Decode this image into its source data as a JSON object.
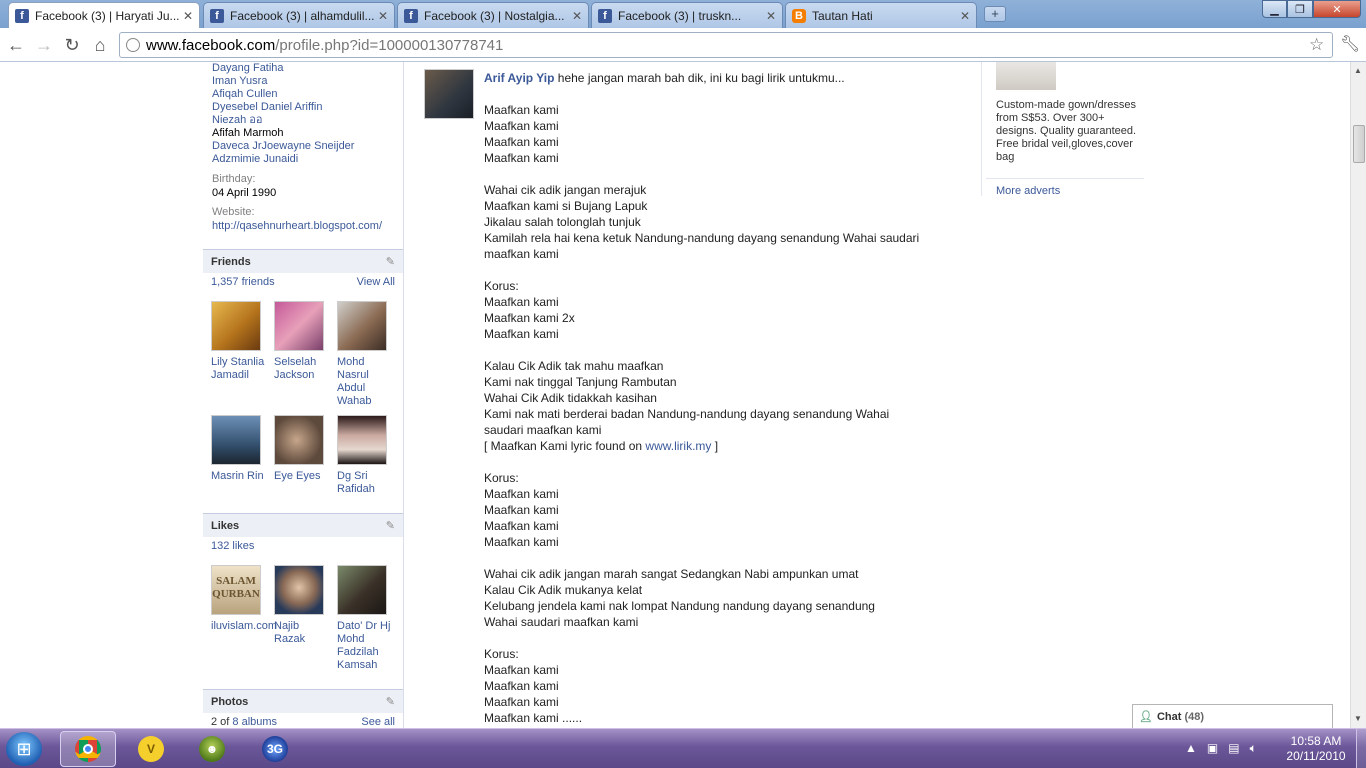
{
  "browser": {
    "tabs": [
      {
        "title": "Facebook (3) | Haryati Ju...",
        "icon": "facebook-favicon",
        "active": true
      },
      {
        "title": "Facebook (3) | alhamdulil...",
        "icon": "facebook-favicon",
        "active": false
      },
      {
        "title": "Facebook (3) | Nostalgia...",
        "icon": "facebook-favicon",
        "active": false
      },
      {
        "title": "Facebook (3) | truskn...",
        "icon": "facebook-favicon",
        "active": false
      },
      {
        "title": "Tautan Hati",
        "icon": "blogger-favicon",
        "active": false
      }
    ],
    "favicon_facebook": "f",
    "favicon_blogger": "B",
    "url_host": "www.facebook.com",
    "url_path": "/profile.php?id=100000130778741"
  },
  "left": {
    "family": [
      "Dayang Fatiha",
      "Iman Yusra",
      "Afiqah Cullen",
      "Dyesebel Daniel Ariffin",
      "Niezah ออ",
      "Afifah Marmoh",
      "Daveca JrJoewayne Sneijder",
      "Adzmimie Junaidi"
    ],
    "birthday_label": "Birthday:",
    "birthday_value": "04 April 1990",
    "website_label": "Website:",
    "website_value": "http://qasehnurheart.blogspot.com/",
    "friends": {
      "title": "Friends",
      "count": "1,357 friends",
      "view_all": "View All",
      "people": [
        "Lily Stanlia Jamadil",
        "Selselah Jackson",
        "Mohd Nasrul Abdul Wahab",
        "Masrin Rin",
        "Eye Eyes",
        "Dg Sri Rafidah"
      ]
    },
    "likes": {
      "title": "Likes",
      "count": "132 likes",
      "pages": [
        "iluvislam.com",
        "Najib Razak",
        "Dato' Dr Hj Mohd Fadzilah Kamsah"
      ],
      "thumb_text": "SALAM QURBAN"
    },
    "photos": {
      "title": "Photos",
      "count_prefix": "2 of ",
      "count_link": "8 albums",
      "see_all": "See all"
    }
  },
  "post": {
    "author": "Arif Ayip Yip",
    "intro": " hehe jangan marah bah dik, ini ku bagi lirik untukmu...",
    "lyrics_part1": "Maafkan kami\nMaafkan kami\nMaafkan kami\nMaafkan kami\n\nWahai cik adik jangan merajuk\nMaafkan kami si Bujang Lapuk\nJikalau salah tolonglah tunjuk\nKamilah rela hai kena ketuk Nandung-nandung dayang senandung Wahai saudari maafkan kami\n\nKorus:\nMaafkan kami\nMaafkan kami 2x\nMaafkan kami\n\nKalau Cik Adik tak mahu maafkan\nKami nak tinggal Tanjung Rambutan\nWahai Cik Adik tidakkah kasihan\nKami nak mati berderai badan Nandung-nandung dayang senandung Wahai saudari maafkan kami",
    "lyric_found_prefix": "[ Maafkan Kami lyric found on ",
    "lyric_found_link": "www.lirik.my",
    "lyric_found_suffix": " ]",
    "lyrics_part2": "\nKorus:\nMaafkan kami\nMaafkan kami\nMaafkan kami\nMaafkan kami\n\nWahai cik adik jangan marah sangat Sedangkan Nabi ampunkan umat\nKalau Cik Adik mukanya kelat\nKelubang jendela kami nak lompat Nandung nandung dayang senandung\nWahai saudari maafkan kami\n\nKorus:\nMaafkan kami\nMaafkan kami\nMaafkan kami\nMaafkan kami ......"
  },
  "ad": {
    "text": "Custom-made gown/dresses from S$53. Over 300+ designs. Quality guaranteed. Free bridal veil,gloves,cover bag",
    "more": "More adverts"
  },
  "chat": {
    "label": "Chat",
    "count": "(48)"
  },
  "taskbar": {
    "time": "10:58 AM",
    "date": "20/11/2010",
    "apps": [
      "chrome-icon",
      "v-app-icon",
      "frog-app-icon",
      "3g-app-icon"
    ]
  }
}
